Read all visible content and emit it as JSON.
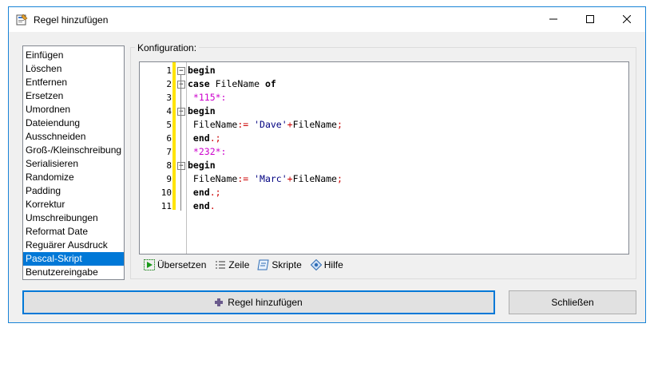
{
  "window": {
    "title": "Regel hinzufügen",
    "controls": {
      "minimize_icon": "minimize-icon",
      "maximize_icon": "maximize-icon",
      "close_icon": "close-icon"
    }
  },
  "rules": [
    {
      "label": "Einfügen",
      "selected": false
    },
    {
      "label": "Löschen",
      "selected": false
    },
    {
      "label": "Entfernen",
      "selected": false
    },
    {
      "label": "Ersetzen",
      "selected": false
    },
    {
      "label": "Umordnen",
      "selected": false
    },
    {
      "label": "Dateiendung",
      "selected": false
    },
    {
      "label": "Ausschneiden",
      "selected": false
    },
    {
      "label": "Groß-/Kleinschreibung",
      "selected": false
    },
    {
      "label": "Serialisieren",
      "selected": false
    },
    {
      "label": "Randomize",
      "selected": false
    },
    {
      "label": "Padding",
      "selected": false
    },
    {
      "label": "Korrektur",
      "selected": false
    },
    {
      "label": "Umschreibungen",
      "selected": false
    },
    {
      "label": "Reformat Date",
      "selected": false
    },
    {
      "label": "Reguärer Ausdruck",
      "selected": false
    },
    {
      "label": "Pascal-Skript",
      "selected": true
    },
    {
      "label": "Benutzereingabe",
      "selected": false
    }
  ],
  "config": {
    "label": "Konfiguration:",
    "editor": {
      "line_numbers": [
        "1",
        "2",
        "3",
        "4",
        "5",
        "6",
        "7",
        "8",
        "9",
        "10",
        "11"
      ],
      "lines": [
        [
          {
            "t": "begin",
            "c": "kw"
          }
        ],
        [
          {
            "t": "case",
            "c": "kw"
          },
          {
            "t": " FileName ",
            "c": "id"
          },
          {
            "t": "of",
            "c": "kw"
          }
        ],
        [
          {
            "t": " *115*:",
            "c": "lbl"
          }
        ],
        [
          {
            "t": "begin",
            "c": "kw"
          }
        ],
        [
          {
            "t": " FileName",
            "c": "id"
          },
          {
            "t": ":=",
            "c": "op"
          },
          {
            "t": " 'Dave'",
            "c": "str"
          },
          {
            "t": "+",
            "c": "op"
          },
          {
            "t": "FileName",
            "c": "id"
          },
          {
            "t": ";",
            "c": "op"
          }
        ],
        [
          {
            "t": " end",
            "c": "kw"
          },
          {
            "t": ".;",
            "c": "op"
          }
        ],
        [
          {
            "t": " *232*:",
            "c": "lbl"
          }
        ],
        [
          {
            "t": "begin",
            "c": "kw"
          }
        ],
        [
          {
            "t": " FileName",
            "c": "id"
          },
          {
            "t": ":=",
            "c": "op"
          },
          {
            "t": " 'Marc'",
            "c": "str"
          },
          {
            "t": "+",
            "c": "op"
          },
          {
            "t": "FileName",
            "c": "id"
          },
          {
            "t": ";",
            "c": "op"
          }
        ],
        [
          {
            "t": " end",
            "c": "kw"
          },
          {
            "t": ".;",
            "c": "op"
          }
        ],
        [
          {
            "t": " end",
            "c": "kw"
          },
          {
            "t": ".",
            "c": "op"
          }
        ]
      ],
      "colors": {
        "keyword": "#000000",
        "operator": "#cc0000",
        "string": "#000080",
        "label": "#cc00cc",
        "change_bar": "#ffe400"
      }
    },
    "toolbar": [
      {
        "label": "Übersetzen",
        "icon": "compile-icon"
      },
      {
        "label": "Zeile",
        "icon": "line-numbers-icon"
      },
      {
        "label": "Skripte",
        "icon": "scripts-icon"
      },
      {
        "label": "Hilfe",
        "icon": "help-icon"
      }
    ]
  },
  "buttons": {
    "add_label": "Regel hinzufügen",
    "add_icon": "plus-icon",
    "close_label": "Schließen"
  }
}
